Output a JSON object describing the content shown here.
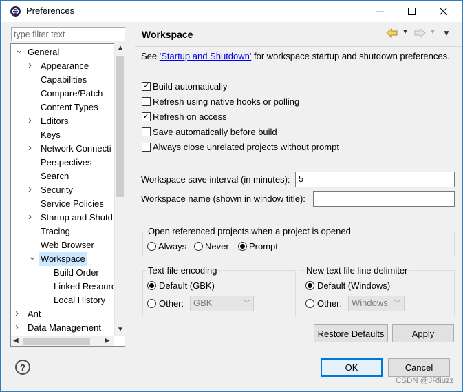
{
  "window": {
    "title": "Preferences"
  },
  "filter": {
    "placeholder": "type filter text"
  },
  "tree": {
    "items": [
      {
        "label": "General",
        "level": 0,
        "expanded": true
      },
      {
        "label": "Appearance",
        "level": 1,
        "expandable": true
      },
      {
        "label": "Capabilities",
        "level": 1
      },
      {
        "label": "Compare/Patch",
        "level": 1
      },
      {
        "label": "Content Types",
        "level": 1
      },
      {
        "label": "Editors",
        "level": 1,
        "expandable": true
      },
      {
        "label": "Keys",
        "level": 1
      },
      {
        "label": "Network Connecti",
        "level": 1,
        "expandable": true
      },
      {
        "label": "Perspectives",
        "level": 1
      },
      {
        "label": "Search",
        "level": 1
      },
      {
        "label": "Security",
        "level": 1,
        "expandable": true
      },
      {
        "label": "Service Policies",
        "level": 1
      },
      {
        "label": "Startup and Shutd",
        "level": 1,
        "expandable": true
      },
      {
        "label": "Tracing",
        "level": 1
      },
      {
        "label": "Web Browser",
        "level": 1
      },
      {
        "label": "Workspace",
        "level": 1,
        "expanded": true,
        "selected": true
      },
      {
        "label": "Build Order",
        "level": 2
      },
      {
        "label": "Linked Resourc",
        "level": 2
      },
      {
        "label": "Local History",
        "level": 2
      },
      {
        "label": "Ant",
        "level": 0,
        "expandable": true
      },
      {
        "label": "Data Management",
        "level": 0,
        "expandable": true
      }
    ]
  },
  "page": {
    "title": "Workspace",
    "intro_prefix": "See ",
    "intro_link": "'Startup and Shutdown'",
    "intro_suffix": " for workspace startup and shutdown preferences.",
    "checkboxes": [
      {
        "label": "Build automatically",
        "checked": true
      },
      {
        "label": "Refresh using native hooks or polling",
        "checked": false
      },
      {
        "label": "Refresh on access",
        "checked": true
      },
      {
        "label": "Save automatically before build",
        "checked": false
      },
      {
        "label": "Always close unrelated projects without prompt",
        "checked": false
      }
    ],
    "save_interval_label": "Workspace save interval (in minutes):",
    "save_interval_value": "5",
    "workspace_name_label": "Workspace name (shown in window title):",
    "workspace_name_value": "",
    "open_ref_group": {
      "title": "Open referenced projects when a project is opened",
      "options": [
        "Always",
        "Never",
        "Prompt"
      ],
      "selected": "Prompt"
    },
    "encoding_group": {
      "title": "Text file encoding",
      "default_label": "Default (GBK)",
      "other_label": "Other:",
      "other_value": "GBK"
    },
    "delimiter_group": {
      "title": "New text file line delimiter",
      "default_label": "Default (Windows)",
      "other_label": "Other:",
      "other_value": "Windows"
    },
    "restore_defaults": "Restore Defaults",
    "apply": "Apply"
  },
  "footer": {
    "ok": "OK",
    "cancel": "Cancel",
    "help": "?"
  },
  "watermark": "CSDN @JRliuzz",
  "colors": {
    "selection": "#cce8ff",
    "primary_border": "#0078d7",
    "link": "#0000ee"
  }
}
